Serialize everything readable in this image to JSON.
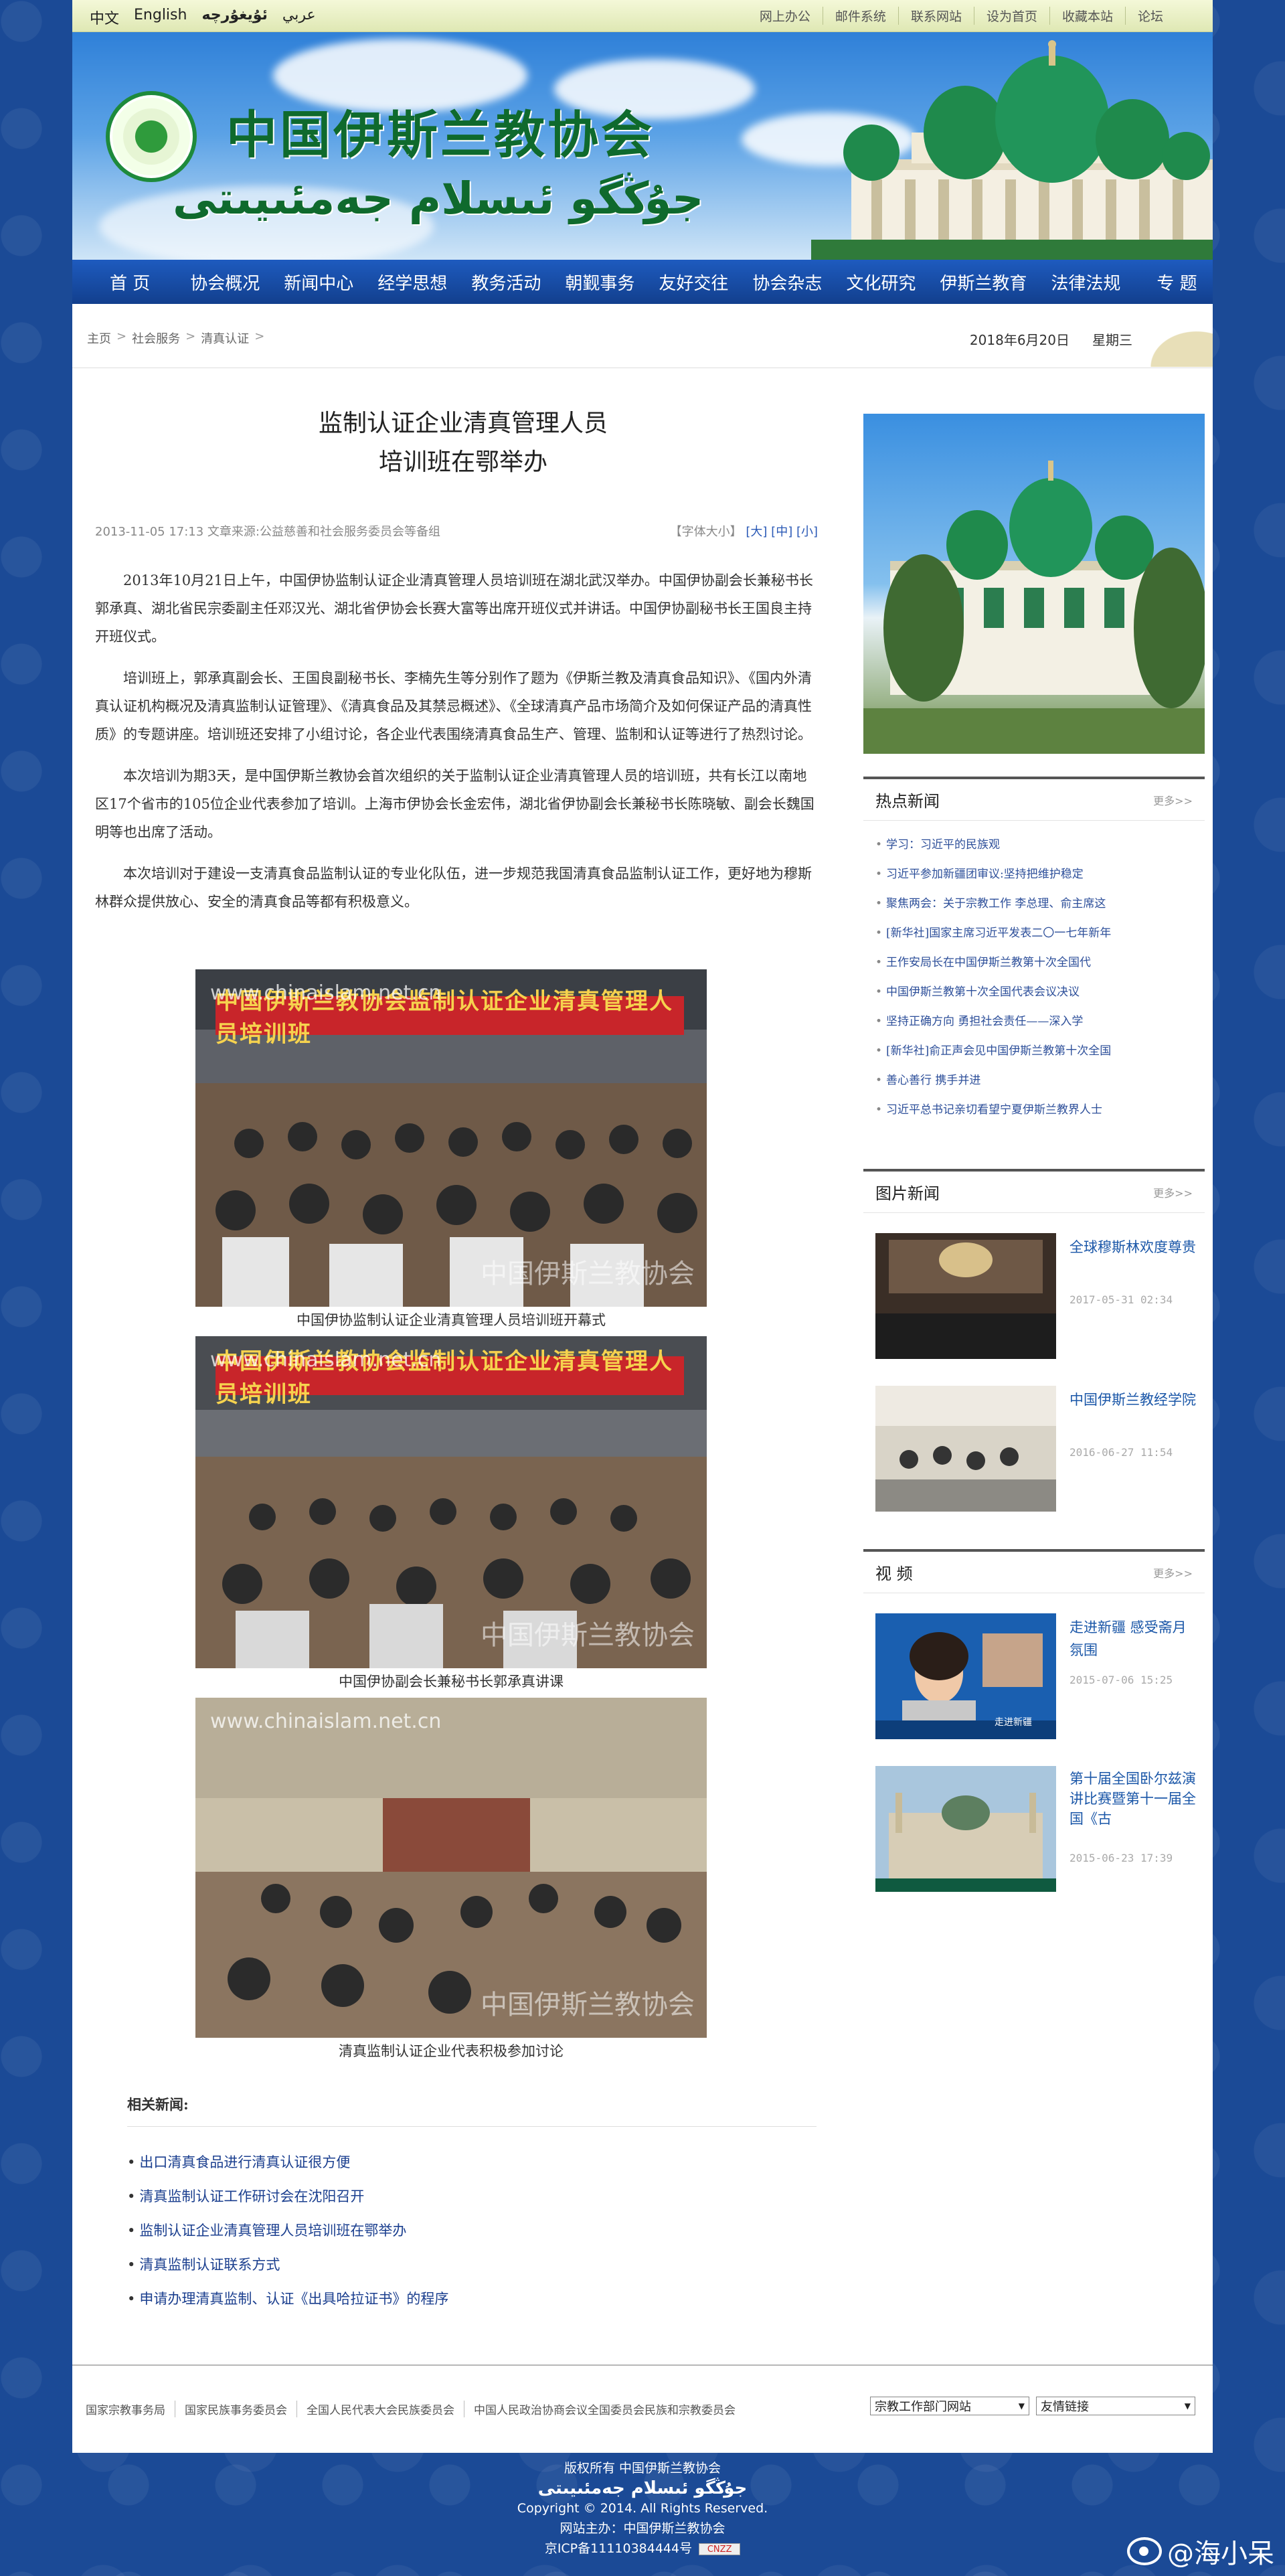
{
  "top_bar": {
    "langs": [
      "中文",
      "English",
      "ئۇيغۇرچە",
      "عربي"
    ],
    "links": [
      "网上办公",
      "邮件系统",
      "联系网站",
      "设为首页",
      "收藏本站",
      "论坛"
    ]
  },
  "banner": {
    "title_cn": "中国伊斯兰教协会",
    "title_ug": "جۇڭگو ئىسلام جەمئىيىتى"
  },
  "nav": [
    "首 页",
    "协会概况",
    "新闻中心",
    "经学思想",
    "教务活动",
    "朝觐事务",
    "友好交往",
    "协会杂志",
    "文化研究",
    "伊斯兰教育",
    "法律法规",
    "专 题"
  ],
  "breadcrumb": {
    "items": [
      "主页",
      "社会服务",
      "清真认证"
    ],
    "date": "2018年6月20日",
    "weekday": "星期三"
  },
  "article": {
    "title_line1": "监制认证企业清真管理人员",
    "title_line2": "培训班在鄂举办",
    "meta": "2013-11-05 17:13 文章来源:公益慈善和社会服务委员会等备组",
    "font_size_label": "【字体大小】",
    "font_sizes": [
      "[大]",
      "[中]",
      "[小]"
    ],
    "paragraphs": [
      "2013年10月21日上午，中国伊协监制认证企业清真管理人员培训班在湖北武汉举办。中国伊协副会长兼秘书长郭承真、湖北省民宗委副主任邓汉光、湖北省伊协会长赛大富等出席开班仪式并讲话。中国伊协副秘书长王国良主持开班仪式。",
      "培训班上，郭承真副会长、王国良副秘书长、李楠先生等分别作了题为《伊斯兰教及清真食品知识》、《国内外清真认证机构概况及清真监制认证管理》、《清真食品及其禁忌概述》、《全球清真产品市场简介及如何保证产品的清真性质》的专题讲座。培训班还安排了小组讨论，各企业代表围绕清真食品生产、管理、监制和认证等进行了热烈讨论。",
      "本次培训为期3天，是中国伊斯兰教协会首次组织的关于监制认证企业清真管理人员的培训班，共有长江以南地区17个省市的105位企业代表参加了培训。上海市伊协会长金宏伟，湖北省伊协副会长兼秘书长陈晓敏、副会长魏国明等也出席了活动。",
      "本次培训对于建设一支清真食品监制认证的专业化队伍，进一步规范我国清真食品监制认证工作，更好地为穆斯林群众提供放心、安全的清真食品等都有积极意义。"
    ],
    "photos": [
      {
        "watermark": "www.chinaislam.net.cn",
        "banner": "中国伊斯兰教协会监制认证企业清真管理人员培训班",
        "stamp": "中国伊斯兰教协会",
        "caption": "中国伊协监制认证企业清真管理人员培训班开幕式"
      },
      {
        "watermark": "www.chinaislam.net.cn",
        "banner": "中国伊斯兰教协会监制认证企业清真管理人员培训班",
        "stamp": "中国伊斯兰教协会",
        "caption": "中国伊协副会长兼秘书长郭承真讲课"
      },
      {
        "watermark": "www.chinaislam.net.cn",
        "banner": "",
        "stamp": "中国伊斯兰教协会",
        "caption": "清真监制认证企业代表积极参加讨论"
      }
    ],
    "related_heading": "相关新闻:",
    "related": [
      "出口清真食品进行清真认证很方便",
      "清真监制认证工作研讨会在沈阳召开",
      "监制认证企业清真管理人员培训班在鄂举办",
      "清真监制认证联系方式",
      "申请办理清真监制、认证《出具哈拉证书》的程序"
    ]
  },
  "sidebar": {
    "hot_news": {
      "title": "热点新闻",
      "more": "更多>>",
      "items": [
        "学习：习近平的民族观",
        "习近平参加新疆团审议:坚持把维护稳定",
        "聚焦两会：关于宗教工作 李总理、俞主席这",
        "[新华社]国家主席习近平发表二〇一七年新年",
        "王作安局长在中国伊斯兰教第十次全国代",
        "中国伊斯兰教第十次全国代表会议决议",
        "坚持正确方向 勇担社会责任——深入学",
        "[新华社]俞正声会见中国伊斯兰教第十次全国",
        "善心善行 携手并进",
        "习近平总书记亲切看望宁夏伊斯兰教界人士"
      ]
    },
    "pic_news": {
      "title": "图片新闻",
      "more": "更多>>",
      "items": [
        {
          "title": "全球穆斯林欢度尊贵",
          "date": "2017-05-31 02:34"
        },
        {
          "title": "中国伊斯兰教经学院",
          "date": "2016-06-27 11:54"
        }
      ]
    },
    "video": {
      "title": "视 频",
      "more": "更多>>",
      "items": [
        {
          "title": "走进新疆 感受斋月氛围",
          "date": "2015-07-06 15:25",
          "tag": "走进新疆"
        },
        {
          "title": "第十届全国卧尔兹演讲比赛暨第十一届全国《古",
          "date": "2015-06-23 17:39"
        }
      ]
    }
  },
  "footer": {
    "links": [
      "国家宗教事务局",
      "国家民族事务委员会",
      "全国人民代表大会民族委员会",
      "中国人民政治协商会议全国委员会民族和宗教委员会"
    ],
    "select1": "宗教工作部门网站",
    "select2": "友情链接",
    "copyright_cn": "版权所有 中国伊斯兰教协会",
    "copyright_ug": "جۇڭگو ئىسلام جەمئىيىتى",
    "copyright_en": "Copyright © 2014. All Rights Reserved.",
    "sponsor": "网站主办：中国伊斯兰教协会",
    "icp": "京ICP备11110384444号",
    "cnzz": "CNZZ"
  },
  "watermark_user": "@海小呆",
  "colors": {
    "nav": "#1a4fa8",
    "page_bg": "#1b4a96",
    "link": "#1b57a8",
    "title_green": "#0f6a2d"
  }
}
